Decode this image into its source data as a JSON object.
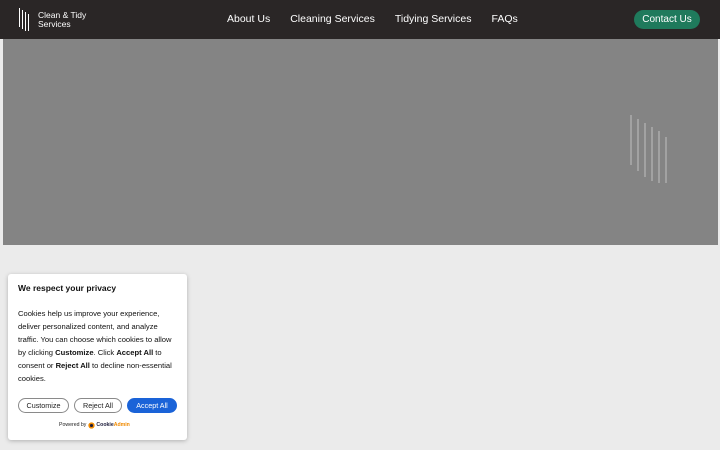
{
  "header": {
    "logo_line1": "Clean & Tidy",
    "logo_line2": "Services",
    "logo_icon": "striped-bars-icon",
    "nav": [
      {
        "label": "About Us"
      },
      {
        "label": "Cleaning Services"
      },
      {
        "label": "Tidying Services"
      },
      {
        "label": "FAQs"
      }
    ],
    "contact_label": "Contact Us"
  },
  "hero": {
    "decoration_icon": "striped-bars-icon"
  },
  "cookie_banner": {
    "title": "We respect your privacy",
    "body": {
      "part1": "Cookies help us improve your experience, deliver personalized content, and analyze traffic. You can choose which cookies to allow by clicking ",
      "bold1": "Customize",
      "part2": ". Click ",
      "bold2": "Accept All",
      "part3": " to consent or ",
      "bold3": "Reject All",
      "part4": " to decline non-essential cookies."
    },
    "buttons": {
      "customize": "Customize",
      "reject": "Reject All",
      "accept": "Accept All"
    },
    "powered_by": "Powered by",
    "brand_part1": "Cookie",
    "brand_part2": "Admin"
  },
  "colors": {
    "header_bg": "#2a2626",
    "accent_green": "#1f7a5c",
    "accept_blue": "#1a63d8",
    "hero_gray": "#848484",
    "page_bg": "#ebebeb"
  }
}
